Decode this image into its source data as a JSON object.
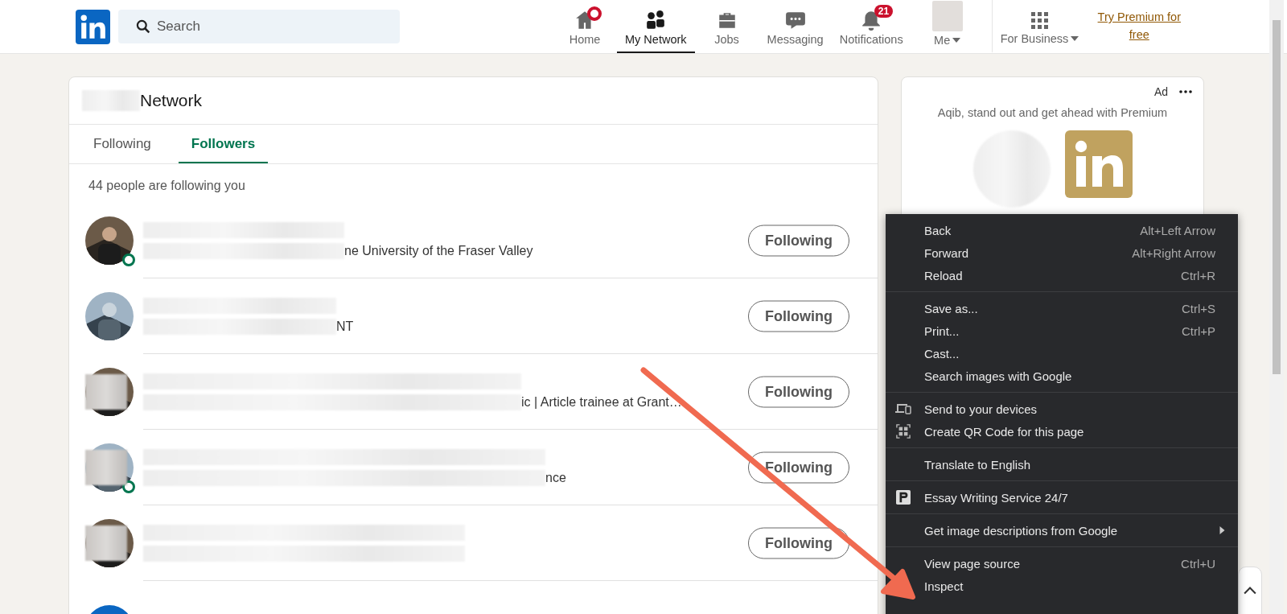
{
  "nav": {
    "search": {
      "placeholder": "Search"
    },
    "items": [
      {
        "label": "Home",
        "selected": false,
        "alert": true
      },
      {
        "label": "My Network",
        "selected": true,
        "alert": false
      },
      {
        "label": "Jobs",
        "selected": false,
        "alert": false
      },
      {
        "label": "Messaging",
        "selected": false,
        "alert": false
      },
      {
        "label": "Notifications",
        "selected": false,
        "alert": false,
        "badge": "21"
      }
    ],
    "me": "Me",
    "business": "For Business",
    "premium": "Try Premium for free"
  },
  "network": {
    "title": "Network",
    "tabs": [
      {
        "label": "Following",
        "selected": false
      },
      {
        "label": "Followers",
        "selected": true
      }
    ],
    "count": "44 people are following you",
    "rows": [
      {
        "subtitle": "ne University of the Fraser Valley",
        "online": true,
        "button": "Following"
      },
      {
        "subtitle": "NT",
        "online": false,
        "button": "Following"
      },
      {
        "subtitle": "ic | Article trainee at Grant…",
        "online": false,
        "button": "Following"
      },
      {
        "subtitle": "nce",
        "online": true,
        "button": "Following"
      },
      {
        "subtitle": "",
        "online": false,
        "button": "Following"
      }
    ]
  },
  "ad": {
    "label": "Ad",
    "text": "Aqib, stand out and get ahead with Premium"
  },
  "context_menu": {
    "groups": [
      [
        {
          "label": "Back",
          "shortcut": "Alt+Left Arrow"
        },
        {
          "label": "Forward",
          "shortcut": "Alt+Right Arrow"
        },
        {
          "label": "Reload",
          "shortcut": "Ctrl+R"
        }
      ],
      [
        {
          "label": "Save as...",
          "shortcut": "Ctrl+S"
        },
        {
          "label": "Print...",
          "shortcut": "Ctrl+P"
        },
        {
          "label": "Cast..."
        },
        {
          "label": "Search images with Google"
        }
      ],
      [
        {
          "label": "Send to your devices"
        },
        {
          "label": "Create QR Code for this page"
        }
      ],
      [
        {
          "label": "Translate to English"
        }
      ],
      [
        {
          "label": "Essay Writing Service 24/7"
        }
      ],
      [
        {
          "label": "Get image descriptions from Google",
          "submenu": true
        }
      ],
      [
        {
          "label": "View page source",
          "shortcut": "Ctrl+U"
        },
        {
          "label": "Inspect"
        }
      ]
    ]
  }
}
